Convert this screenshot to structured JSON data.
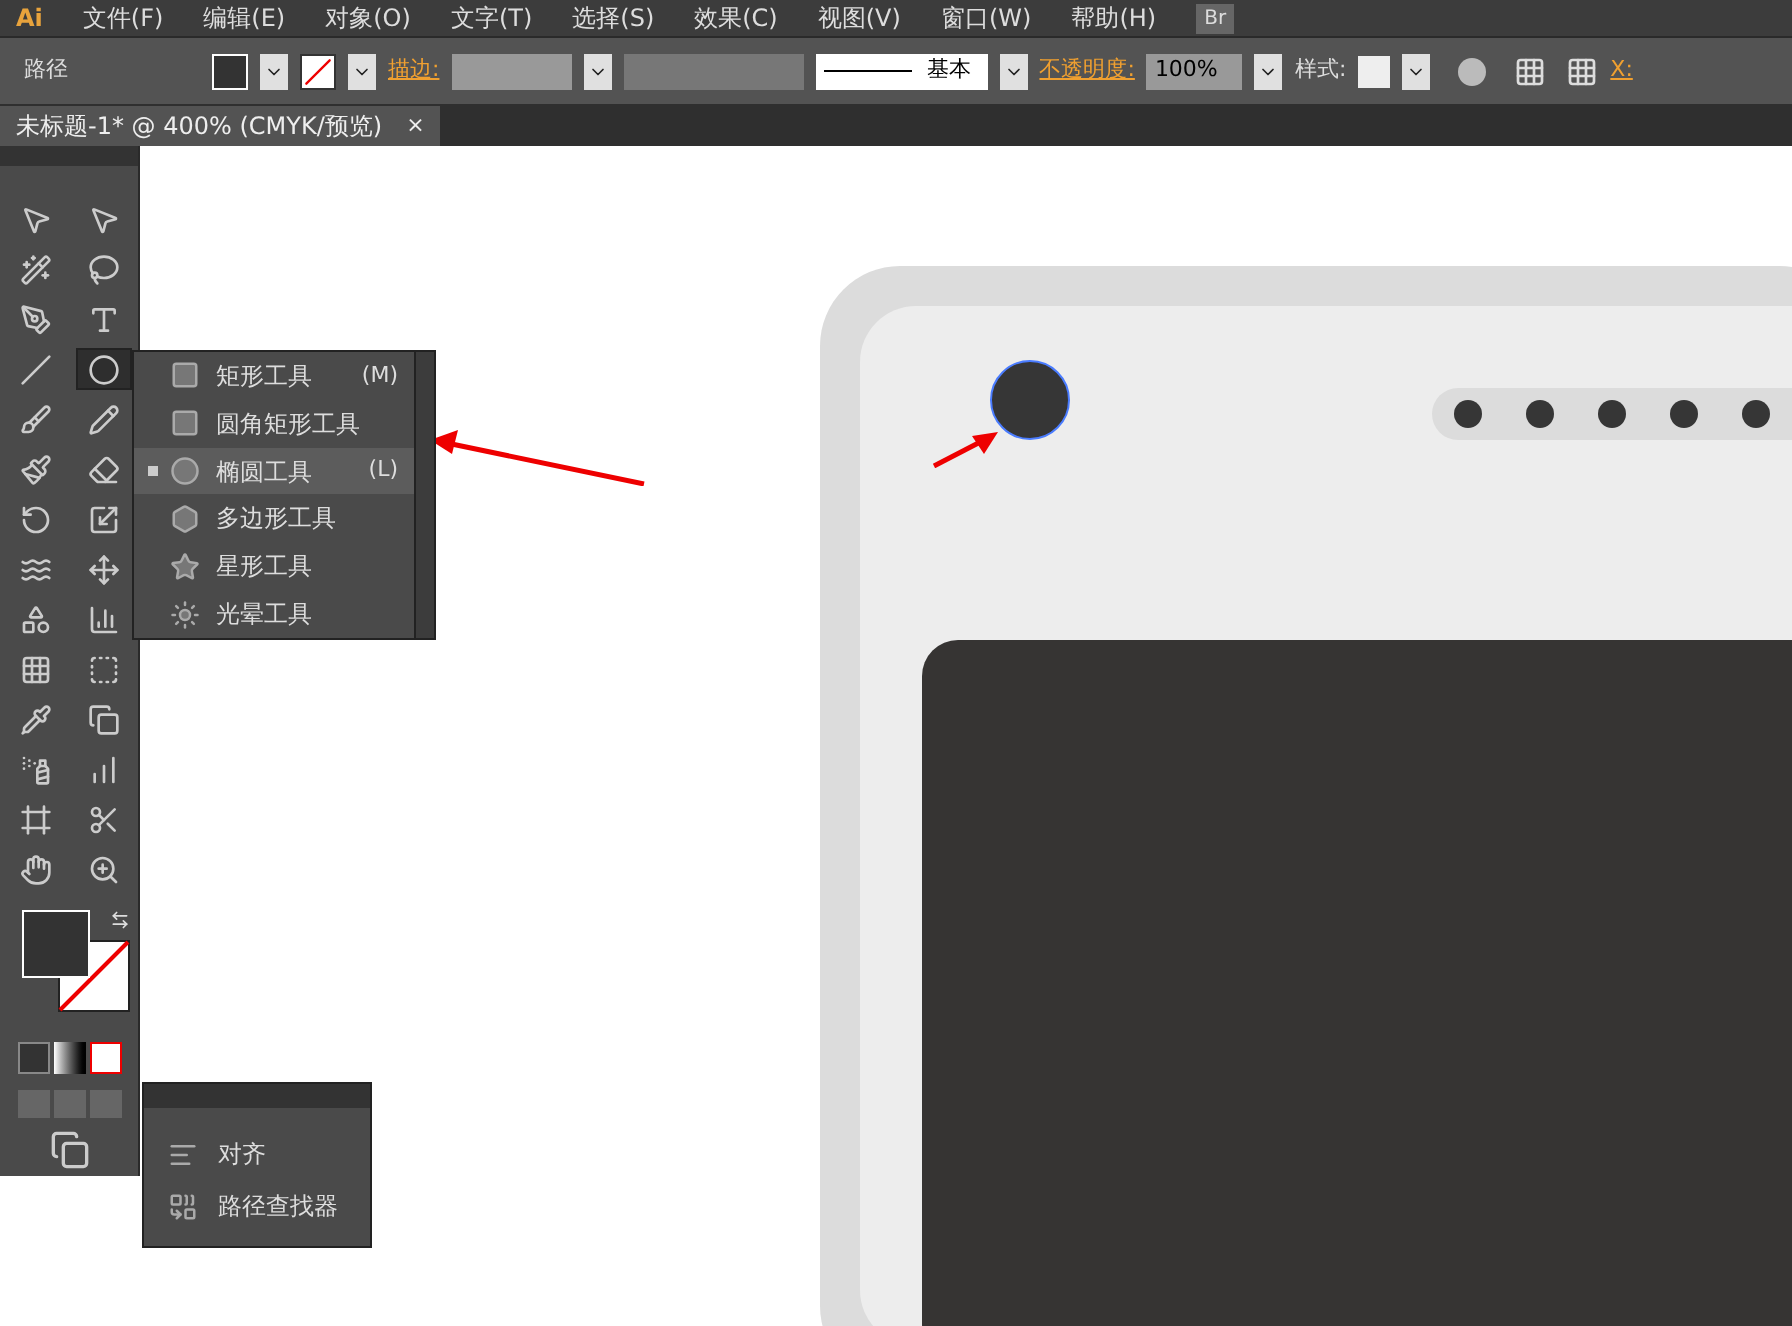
{
  "menu_bar": {
    "logo": "Ai",
    "items": [
      "文件(F)",
      "编辑(E)",
      "对象(O)",
      "文字(T)",
      "选择(S)",
      "效果(C)",
      "视图(V)",
      "窗口(W)",
      "帮助(H)"
    ],
    "bridge": "Br"
  },
  "control_bar": {
    "object_type": "路径",
    "stroke_label": "描边:",
    "line_style": "基本",
    "opacity_label": "不透明度:",
    "opacity_value": "100%",
    "style_label": "样式:",
    "x_label": "X:"
  },
  "document_tab": {
    "title": "未标题-1* @ 400% (CMYK/预览)",
    "close": "×"
  },
  "toolbox": {
    "tools": [
      {
        "kind": "select",
        "selected": false
      },
      {
        "kind": "direct",
        "selected": false
      },
      {
        "kind": "wand",
        "selected": false
      },
      {
        "kind": "lasso",
        "selected": false
      },
      {
        "kind": "pen",
        "selected": false
      },
      {
        "kind": "type",
        "selected": false
      },
      {
        "kind": "line",
        "selected": false
      },
      {
        "kind": "ellipse",
        "selected": true
      },
      {
        "kind": "brush",
        "selected": false
      },
      {
        "kind": "pencil",
        "selected": false
      },
      {
        "kind": "blob",
        "selected": false
      },
      {
        "kind": "eraser",
        "selected": false
      },
      {
        "kind": "rotate",
        "selected": false
      },
      {
        "kind": "scale",
        "selected": false
      },
      {
        "kind": "warp",
        "selected": false
      },
      {
        "kind": "transform",
        "selected": false
      },
      {
        "kind": "shape",
        "selected": false
      },
      {
        "kind": "graph",
        "selected": false
      },
      {
        "kind": "mesh",
        "selected": false
      },
      {
        "kind": "gradient",
        "selected": false
      },
      {
        "kind": "eyedropper",
        "selected": false
      },
      {
        "kind": "blend",
        "selected": false
      },
      {
        "kind": "spray",
        "selected": false
      },
      {
        "kind": "column",
        "selected": false
      },
      {
        "kind": "artboard",
        "selected": false
      },
      {
        "kind": "slice",
        "selected": false
      },
      {
        "kind": "hand",
        "selected": false
      },
      {
        "kind": "zoom",
        "selected": false
      }
    ]
  },
  "shape_flyout": {
    "items": [
      {
        "kind": "rect",
        "label": "矩形工具",
        "shortcut": "(M)",
        "selected": false
      },
      {
        "kind": "rounded",
        "label": "圆角矩形工具",
        "selected": false
      },
      {
        "kind": "ellipse",
        "label": "椭圆工具",
        "shortcut": "(L)",
        "selected": true
      },
      {
        "kind": "polygon",
        "label": "多边形工具",
        "selected": false
      },
      {
        "kind": "star",
        "label": "星形工具",
        "selected": false
      },
      {
        "kind": "flare",
        "label": "光晕工具",
        "selected": false
      }
    ]
  },
  "mini_panel": {
    "items": [
      {
        "kind": "align",
        "label": "对齐"
      },
      {
        "kind": "pathfinder",
        "label": "路径查找器"
      }
    ]
  }
}
